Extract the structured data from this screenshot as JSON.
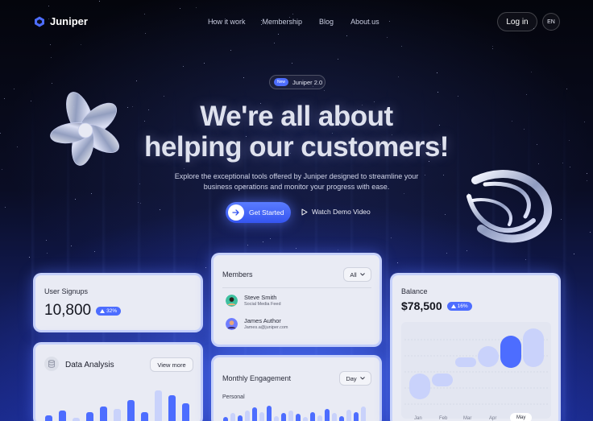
{
  "nav": {
    "logo": "Juniper",
    "links": [
      "How it work",
      "Membership",
      "Blog",
      "About us"
    ],
    "login": "Log in",
    "lang": "EN"
  },
  "hero": {
    "badge_new": "New",
    "badge_text": "Juniper 2.0",
    "headline_line1": "We're all about",
    "headline_line2": "helping our customers!",
    "sub_line1": "Explore the exceptional tools offered by Juniper designed to streamline your",
    "sub_line2": "business operations and monitor your progress with ease.",
    "cta": "Get Started",
    "demo": "Watch Demo Video"
  },
  "signups": {
    "title": "User Signups",
    "value": "10,800",
    "change": "32%"
  },
  "analysis": {
    "title": "Data Analysis",
    "button": "View more",
    "bars": [
      0.22,
      0.35,
      0.15,
      0.3,
      0.45,
      0.4,
      0.62,
      0.3,
      0.9,
      0.75,
      0.55
    ]
  },
  "members": {
    "title": "Members",
    "filter": "All",
    "list": [
      {
        "name": "Steve Smith",
        "sub": "Social Media Feed"
      },
      {
        "name": "James Author",
        "sub": "James.a@juniper.com"
      }
    ]
  },
  "engagement": {
    "title": "Monthly Engagement",
    "filter": "Day",
    "label": "Personal",
    "bars": [
      0.3,
      0.5,
      0.4,
      0.6,
      0.75,
      0.55,
      0.85,
      0.35,
      0.5,
      0.6,
      0.45,
      0.3,
      0.55,
      0.4,
      0.7,
      0.5,
      0.35,
      0.65,
      0.55,
      0.8
    ]
  },
  "balance": {
    "title": "Balance",
    "value": "$78,500",
    "change": "16%",
    "months": [
      "Jan",
      "Feb",
      "Mar",
      "Apr",
      "May"
    ],
    "selected_month": "May"
  },
  "colors": {
    "accent": "#4d6dff",
    "accent_light": "#c9d2fb"
  }
}
